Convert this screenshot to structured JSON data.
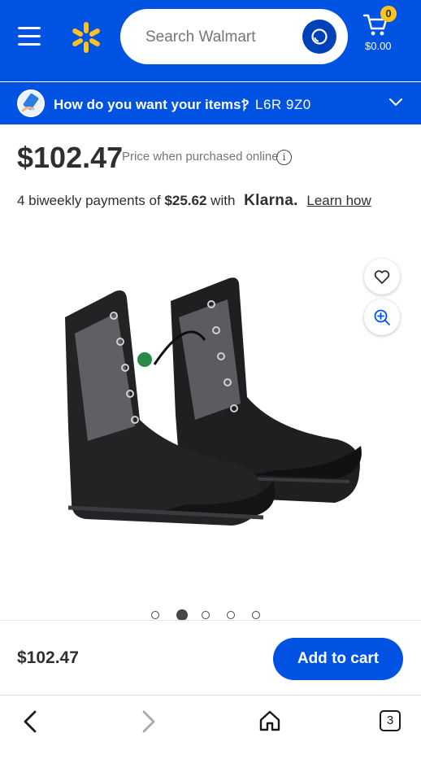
{
  "header": {
    "search_placeholder": "Search Walmart",
    "cart_count": "0",
    "cart_total": "$0.00",
    "brand_color": "#0053e2",
    "spark_color": "#ffc220"
  },
  "delivery": {
    "question": "How do you want your items?",
    "separator": "|",
    "postal_code": "L6R 9Z0"
  },
  "product": {
    "price": "$102.47",
    "price_note": "Price when purchased online",
    "installment_prefix": "4 biweekly payments of",
    "installment_amount": "$25.62",
    "installment_with": "with",
    "klarna": "Klarna.",
    "learn_how": "Learn how",
    "image_icon": "work-boots",
    "carousel_total": 5,
    "carousel_active": 2
  },
  "footer": {
    "price": "$102.47",
    "add_to_cart": "Add to cart"
  },
  "browser": {
    "tab_count": "3"
  }
}
